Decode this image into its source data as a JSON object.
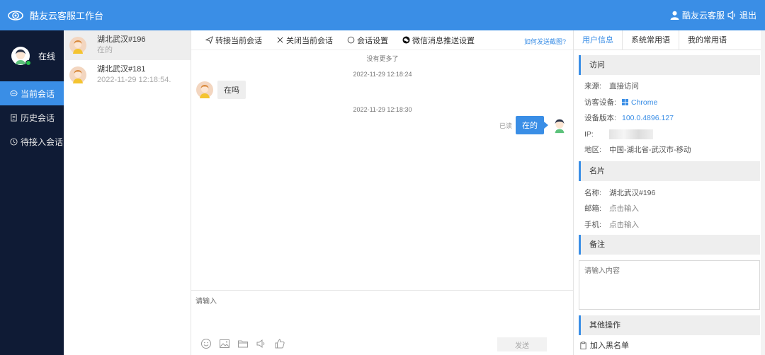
{
  "header": {
    "title": "酷友云客服工作台",
    "user": "酷友云客服",
    "logout": "退出"
  },
  "sidenav": {
    "status": "在线",
    "items": [
      {
        "label": "当前会话",
        "icon": "chat-bubble-icon"
      },
      {
        "label": "历史会话",
        "icon": "document-icon"
      },
      {
        "label": "待接入会话",
        "icon": "clock-icon"
      }
    ]
  },
  "sessions": [
    {
      "name": "湖北武汉#196",
      "sub": "在的"
    },
    {
      "name": "湖北武汉#181",
      "sub": "2022-11-29 12:18:54."
    }
  ],
  "chat": {
    "toolbar": [
      "转接当前会话",
      "关闭当前会话",
      "会话设置",
      "微信消息推送设置"
    ],
    "help": "如何发送截图?",
    "no_more": "没有更多了",
    "msg1_time": "2022-11-29 12:18:24",
    "msg1_text": "在吗",
    "msg2_time": "2022-11-29 12:18:30",
    "msg2_text": "在的",
    "msg2_read": "已读",
    "input_placeholder": "请输入",
    "send": "发送"
  },
  "panel": {
    "tabs": [
      "用户信息",
      "系统常用语",
      "我的常用语"
    ],
    "visit": {
      "title": "访问",
      "source_label": "来源:",
      "source": "直接访问",
      "device_label": "访客设备:",
      "device": "Chrome",
      "version_label": "设备版本:",
      "version": "100.0.4896.127",
      "ip_label": "IP:",
      "region_label": "地区:",
      "region": "中国-湖北省-武汉市-移动"
    },
    "card": {
      "title": "名片",
      "name_label": "名称:",
      "name": "湖北武汉#196",
      "email_label": "邮箱:",
      "email": "点击输入",
      "phone_label": "手机:",
      "phone": "点击输入"
    },
    "note": {
      "title": "备注",
      "placeholder": "请输入内容"
    },
    "other": {
      "title": "其他操作",
      "blacklist": "加入黑名单"
    }
  },
  "colors": {
    "accent": "#3a8ee6",
    "sidebar": "#0f1b35",
    "online": "#27c24c"
  }
}
